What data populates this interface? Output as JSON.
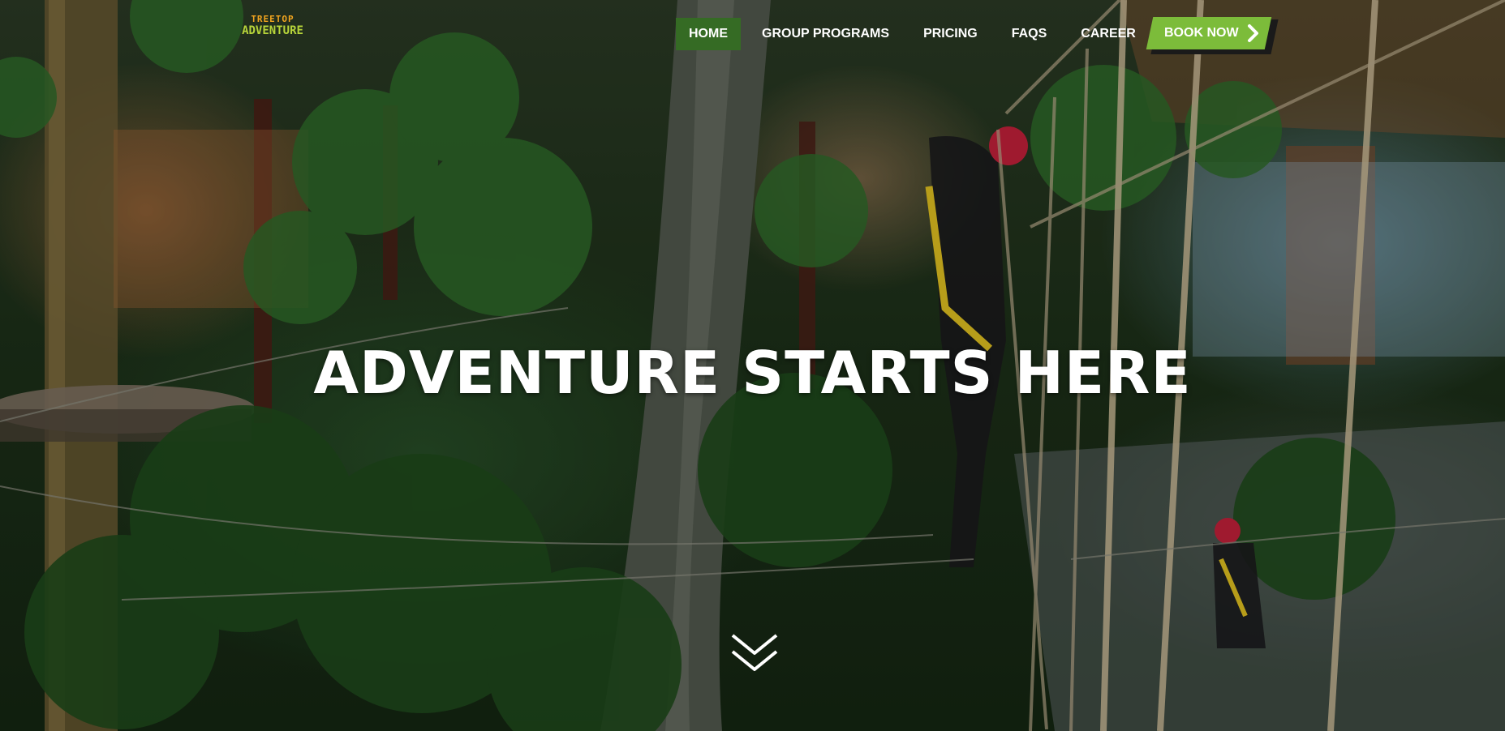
{
  "logo": {
    "line1": "TREETOP",
    "line2": "ADVENTURE"
  },
  "nav": {
    "items": [
      {
        "label": "HOME",
        "active": true
      },
      {
        "label": "GROUP PROGRAMS",
        "active": false
      },
      {
        "label": "PRICING",
        "active": false
      },
      {
        "label": "FAQS",
        "active": false
      },
      {
        "label": "CAREER",
        "active": false
      }
    ],
    "cta": {
      "label": "BOOK NOW",
      "icon": "chevron-right-icon"
    }
  },
  "hero": {
    "title": "ADVENTURE STARTS HERE",
    "scroll_icon": "double-chevron-down-icon"
  },
  "colors": {
    "active_nav_bg": "#356b24",
    "cta_bg": "#7cbc3a",
    "text": "#ffffff"
  }
}
